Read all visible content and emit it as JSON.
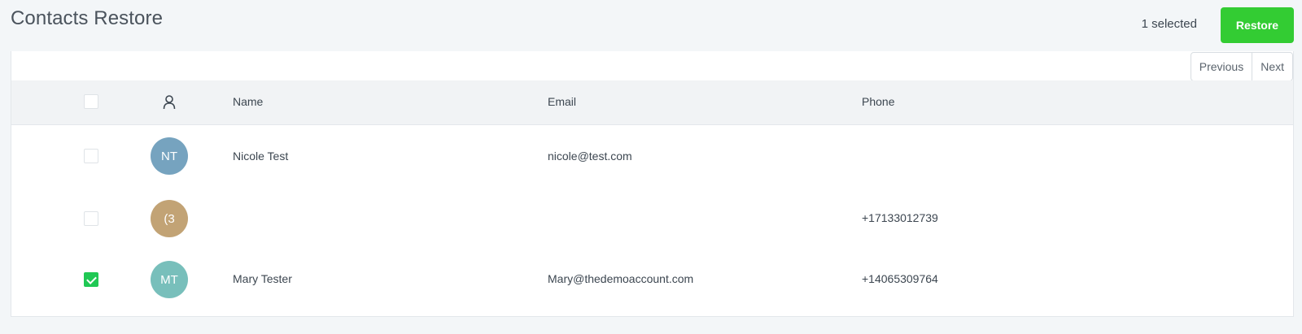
{
  "page": {
    "title": "Contacts Restore",
    "selected_text": "1 selected",
    "restore_label": "Restore"
  },
  "pager": {
    "previous_label": "Previous",
    "next_label": "Next"
  },
  "table": {
    "header_icon": "person-icon",
    "columns": {
      "name": "Name",
      "email": "Email",
      "phone": "Phone"
    },
    "rows": [
      {
        "initials": "NT",
        "avatar_color": "#76a3bf",
        "name": "Nicole Test",
        "email": "nicole@test.com",
        "phone": "",
        "checked": false
      },
      {
        "initials": "(3",
        "avatar_color": "#c2a375",
        "name": "",
        "email": "",
        "phone": "+17133012739",
        "checked": false
      },
      {
        "initials": "MT",
        "avatar_color": "#78bfbb",
        "name": "Mary Tester",
        "email": "Mary@thedemoaccount.com",
        "phone": "+14065309764",
        "checked": true
      }
    ]
  },
  "colors": {
    "restore_button": "#33cc33",
    "checkbox_checked": "#20c854",
    "page_background": "#f3f6f8",
    "header_background": "#f1f3f5"
  }
}
